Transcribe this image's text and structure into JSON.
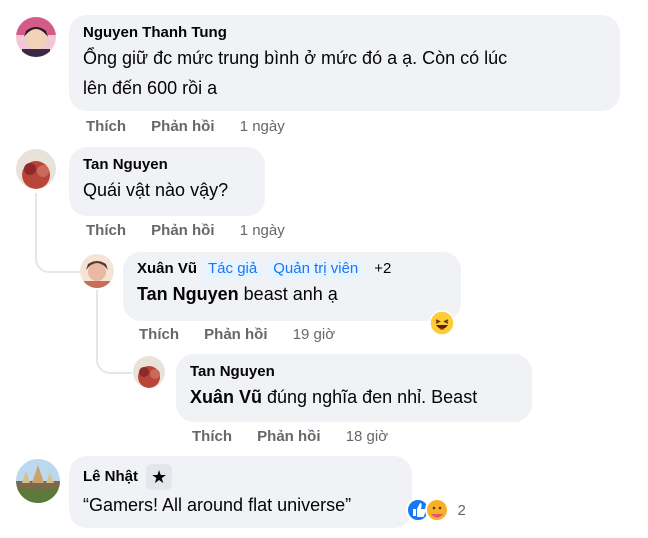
{
  "comments": [
    {
      "author": "Nguyen Thanh Tung",
      "line1": "Ổng giữ đc mức trung bình ở mức đó a ạ. Còn có lúc",
      "line2": "lên đến 600 rồi a",
      "like": "Thích",
      "reply": "Phản hồi",
      "time": "1 ngày"
    },
    {
      "author": "Tan Nguyen",
      "text": "Quái vật nào vậy?",
      "like": "Thích",
      "reply": "Phản hồi",
      "time": "1 ngày"
    }
  ],
  "replies": [
    {
      "author": "Xuân Vũ",
      "badges": [
        "Tác giả",
        "Quản trị viên",
        "+2"
      ],
      "mention": "Tan Nguyen",
      "text": " beast anh ạ",
      "reaction": "haha-emoji",
      "like": "Thích",
      "reply": "Phản hồi",
      "time": "19 giờ"
    },
    {
      "author": "Tan Nguyen",
      "mention": "Xuân Vũ",
      "text": " đúng nghĩa đen nhỉ. Beast",
      "like": "Thích",
      "reply": "Phản hồi",
      "time": "18 giờ"
    }
  ],
  "last_comment": {
    "author": "Lê Nhật",
    "badge_icon": "star-icon",
    "text": "“Gamers! All around flat universe”",
    "reaction_count": "2",
    "reactions": [
      "like-icon",
      "care-icon"
    ]
  },
  "colors": {
    "bubble": "#f0f2f5",
    "meta": "#65676b",
    "badge_text": "#1877f2",
    "badge_bg": "#e7f3ff"
  }
}
